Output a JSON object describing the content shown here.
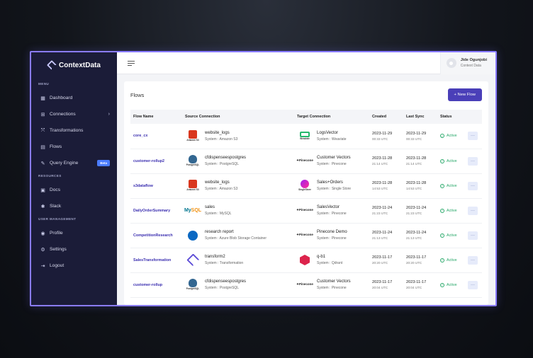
{
  "brand": {
    "name": "ContextData"
  },
  "sidebar": {
    "menu_label": "MENU",
    "menu_items": [
      {
        "label": "Dashboard",
        "icon": "dashboard-icon"
      },
      {
        "label": "Connections",
        "icon": "connections-icon"
      },
      {
        "label": "Transformations",
        "icon": "transformations-icon"
      },
      {
        "label": "Flows",
        "icon": "flows-icon"
      },
      {
        "label": "Query Engine",
        "icon": "query-engine-icon",
        "badge": "Beta"
      }
    ],
    "resources_label": "RESOURCES",
    "resource_items": [
      {
        "label": "Docs",
        "icon": "docs-icon"
      },
      {
        "label": "Slack",
        "icon": "slack-icon"
      }
    ],
    "users_label": "USER MANAGEMENT",
    "user_items": [
      {
        "label": "Profile",
        "icon": "profile-icon"
      },
      {
        "label": "Settings",
        "icon": "settings-icon"
      },
      {
        "label": "Logout",
        "icon": "logout-icon"
      }
    ]
  },
  "header": {
    "user_name": "Jide Ogunjobi",
    "user_org": "Context Data"
  },
  "page": {
    "title": "Flows",
    "new_button": "+ New Flow"
  },
  "table": {
    "columns": [
      "Flow Name",
      "Source Connection",
      "Target Connection",
      "Created",
      "Last Sync",
      "Status"
    ],
    "rows": [
      {
        "name": "core_cx",
        "src": "website_logs",
        "src_sys": "System : Amazon S3",
        "src_logo": "Amazon S3",
        "tgt": "LogsVector",
        "tgt_sys": "System : Weaviate",
        "tgt_logo": "Weaviate",
        "created": "2023-11-29",
        "created_t": "00:33 UTC",
        "sync": "2023-11-29",
        "sync_t": "00:33 UTC",
        "status": "Active"
      },
      {
        "name": "customer-rollup2",
        "src": "cfdispenseespostgres",
        "src_sys": "System : PostgreSQL",
        "src_logo": "PostgreSQL",
        "tgt": "Customer Vectors",
        "tgt_sys": "System : Pinecone",
        "tgt_logo": "Pinecone",
        "created": "2023-11-28",
        "created_t": "21:14 UTC",
        "sync": "2023-11-28",
        "sync_t": "21:14 UTC",
        "status": "Active"
      },
      {
        "name": "s3dataflow",
        "src": "website_logs",
        "src_sys": "System : Amazon S3",
        "src_logo": "Amazon S3",
        "tgt": "Sales+Orders",
        "tgt_sys": "System : Single Store",
        "tgt_logo": "SingleStore",
        "created": "2023-11-28",
        "created_t": "14:53 UTC",
        "sync": "2023-11-28",
        "sync_t": "14:53 UTC",
        "status": "Active"
      },
      {
        "name": "DailyOrderSummary",
        "src": "sales",
        "src_sys": "System : MySQL",
        "src_logo": "MySQL",
        "tgt": "SalesVector",
        "tgt_sys": "System : Pinecone",
        "tgt_logo": "Pinecone",
        "created": "2023-11-24",
        "created_t": "21:23 UTC",
        "sync": "2023-11-24",
        "sync_t": "21:23 UTC",
        "status": "Active"
      },
      {
        "name": "CompetitionResearch",
        "src": "research report",
        "src_sys": "System : Azure Blob Storage Container",
        "src_logo": "Azure",
        "tgt": "Pinecone Demo",
        "tgt_sys": "System : Pinecone",
        "tgt_logo": "Pinecone",
        "created": "2023-11-24",
        "created_t": "21:13 UTC",
        "sync": "2023-11-24",
        "sync_t": "21:13 UTC",
        "status": "Active"
      },
      {
        "name": "SalesTransformation",
        "src": "transform2",
        "src_sys": "System : Transformation",
        "src_logo": "Transformation",
        "tgt": "q-b1",
        "tgt_sys": "System : Qdrant",
        "tgt_logo": "Qdrant",
        "created": "2023-11-17",
        "created_t": "20:20 UTC",
        "sync": "2023-11-17",
        "sync_t": "20:20 UTC",
        "status": "Active"
      },
      {
        "name": "customer-rollup",
        "src": "cfdispenseespostgres",
        "src_sys": "System : PostgreSQL",
        "src_logo": "PostgreSQL",
        "tgt": "Customer Vectors",
        "tgt_sys": "System : Pinecone",
        "tgt_logo": "Pinecone",
        "created": "2023-11-17",
        "created_t": "20:04 UTC",
        "sync": "2023-11-17",
        "sync_t": "20:04 UTC",
        "status": "Active"
      }
    ]
  },
  "colors": {
    "sidebar": "#1b1c38",
    "accent": "#4a3fb8",
    "active": "#2aa96b"
  }
}
